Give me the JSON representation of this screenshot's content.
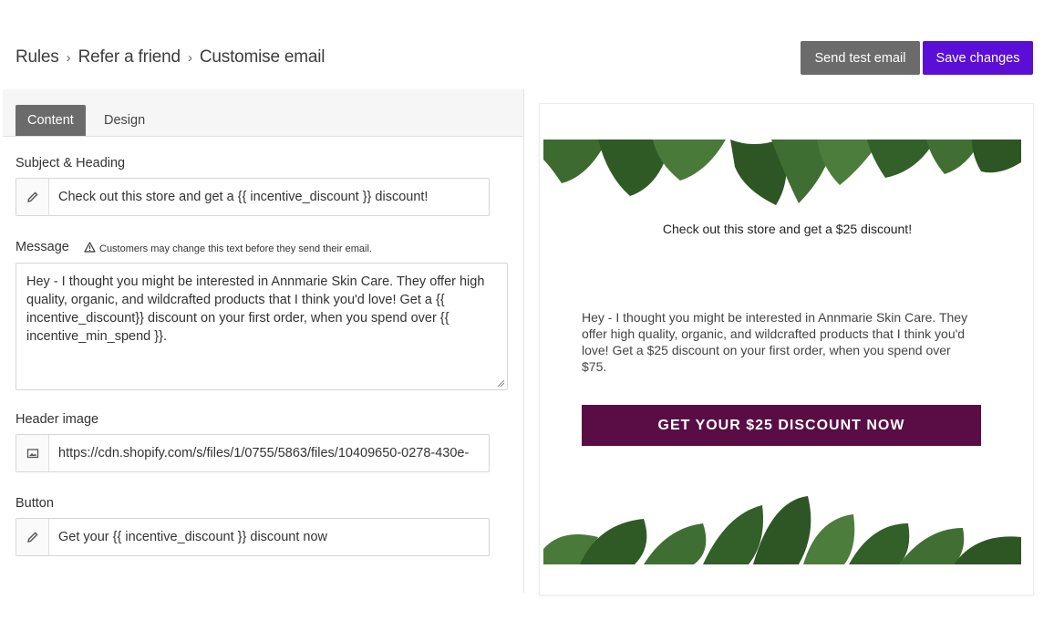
{
  "breadcrumb": {
    "parts": [
      "Rules",
      "Refer a friend",
      "Customise email"
    ],
    "separator": "›"
  },
  "actions": {
    "send_test": "Send test email",
    "save": "Save changes"
  },
  "tabs": [
    {
      "label": "Content",
      "active": true
    },
    {
      "label": "Design",
      "active": false
    }
  ],
  "form": {
    "subject": {
      "label": "Subject & Heading",
      "value": "Check out this store and get a {{ incentive_discount }} discount!",
      "icon": "pencil-icon"
    },
    "message": {
      "label": "Message",
      "warning": "Customers may change this text before they send their email.",
      "value": "Hey - I thought you might be interested in Annmarie Skin Care. They offer high quality, organic, and wildcrafted products that I think you'd love! Get a {{ incentive_discount}} discount on your first order, when you spend over {{ incentive_min_spend }}."
    },
    "header_image": {
      "label": "Header image",
      "value": "https://cdn.shopify.com/s/files/1/0755/5863/files/10409650-0278-430e-",
      "icon": "image-icon"
    },
    "button": {
      "label": "Button",
      "value": "Get your {{ incentive_discount }} discount now",
      "icon": "pencil-icon"
    }
  },
  "preview": {
    "heading": "Check out this store and get a $25 discount!",
    "body": "Hey - I thought you might be interested in Annmarie Skin Care. They offer high quality, organic, and wildcrafted products that I think you'd love! Get a $25 discount on your first order, when you spend over $75.",
    "cta": "GET YOUR $25 DISCOUNT NOW",
    "cta_color": "#5a0d45",
    "leaf_color": "#3d6b2f"
  },
  "colors": {
    "primary": "#5b0fd6",
    "secondary": "#6b6b6b"
  }
}
